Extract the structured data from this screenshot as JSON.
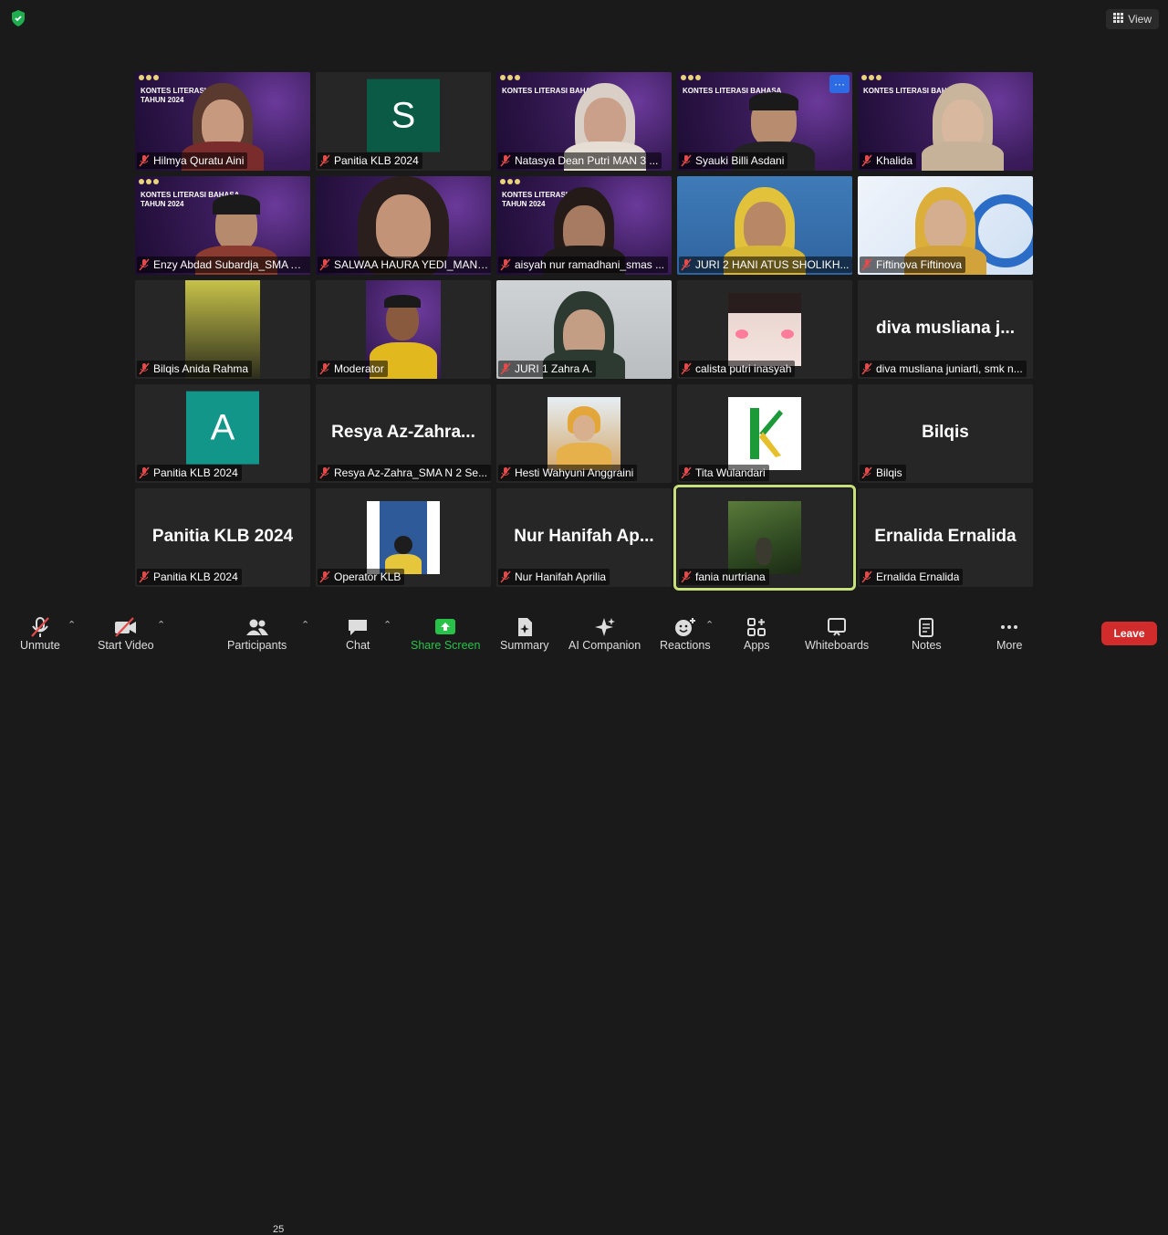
{
  "top": {
    "view_label": "View"
  },
  "slide": {
    "title1": "KONTES LITERASI BAHASA",
    "title2": "TAHUN 2024"
  },
  "tiles": [
    {
      "label": "Hilmya Quratu Aini"
    },
    {
      "label": "Panitia KLB 2024",
      "avatar": "S"
    },
    {
      "label": "Natasya Dean Putri MAN 3 ..."
    },
    {
      "label": "Syauki Billi Asdani"
    },
    {
      "label": "Khalida"
    },
    {
      "label": "Enzy Abdad Subardja_SMA Al A..."
    },
    {
      "label": "SALWAA HAURA YEDI_MAN ..."
    },
    {
      "label": "aisyah nur ramadhani_smas ..."
    },
    {
      "label": "JURI 2 HANI ATUS SHOLIKH..."
    },
    {
      "label": "Fiftinova Fiftinova"
    },
    {
      "label": "Bilqis Anida Rahma"
    },
    {
      "label": "Moderator"
    },
    {
      "label": "JURI 1 Zahra A."
    },
    {
      "label": "calista putri inasyah"
    },
    {
      "label": "diva musliana juniarti, smk n...",
      "big_name": "diva musliana j..."
    },
    {
      "label": "Panitia KLB 2024",
      "avatar": "A"
    },
    {
      "label": "Resya Az-Zahra_SMA N 2 Se...",
      "big_name": "Resya  Az-Zahra..."
    },
    {
      "label": "Hesti Wahyuni Anggraini"
    },
    {
      "label": "Tita Wulandari"
    },
    {
      "label": "Bilqis",
      "big_name": "Bilqis"
    },
    {
      "label": "Panitia KLB 2024",
      "big_name": "Panitia KLB 2024"
    },
    {
      "label": "Operator KLB"
    },
    {
      "label": "Nur Hanifah Aprilia",
      "big_name": "Nur  Hanifah  Ap..."
    },
    {
      "label": "fania nurtriana"
    },
    {
      "label": "Ernalida Ernalida",
      "big_name": "Ernalida Ernalida"
    }
  ],
  "toolbar": {
    "unmute": "Unmute",
    "start_video": "Start Video",
    "participants": "Participants",
    "participants_count": "25",
    "chat": "Chat",
    "share_screen": "Share Screen",
    "summary": "Summary",
    "ai_companion": "AI Companion",
    "reactions": "Reactions",
    "apps": "Apps",
    "whiteboards": "Whiteboards",
    "notes": "Notes",
    "more": "More",
    "leave": "Leave"
  },
  "colors": {
    "accent_green": "#0e8a3c",
    "active_border": "#c8e07a",
    "leave_red": "#d12b2b",
    "share_green": "#28c24a"
  }
}
